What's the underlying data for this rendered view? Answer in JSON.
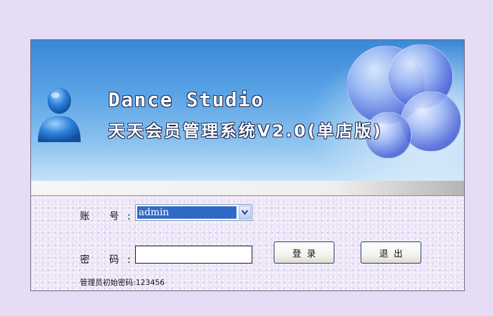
{
  "banner": {
    "title_en": "Dance Studio",
    "title_cn": "天天会员管理系统V2.0(单店版)"
  },
  "form": {
    "account_label": "账 号:",
    "account_value": "admin",
    "password_label": "密 码:",
    "password_value": "",
    "login_label": "登录",
    "exit_label": "退出",
    "hint": "管理员初始密码:123456"
  },
  "colors": {
    "desktop": "#e6dcf6",
    "banner_blue": "#3a88d6",
    "selection": "#316ac5"
  }
}
